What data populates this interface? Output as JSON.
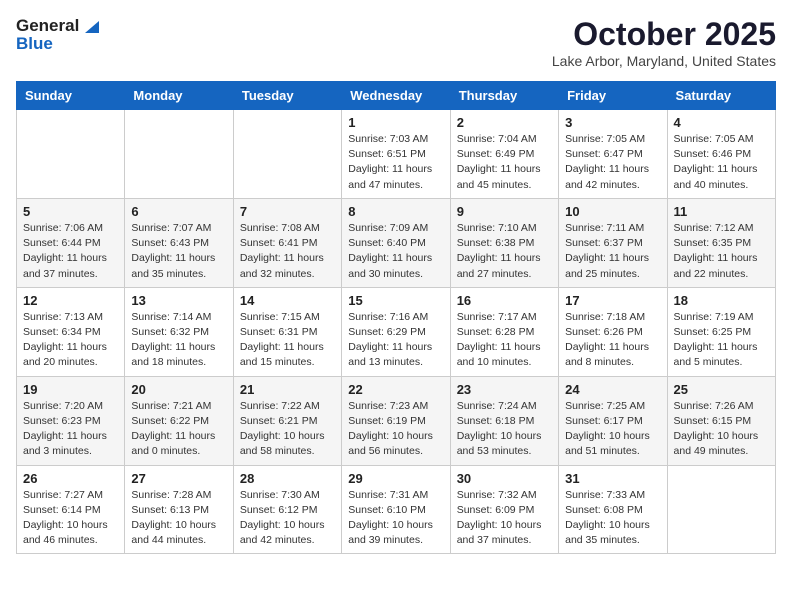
{
  "logo": {
    "line1": "General",
    "line2": "Blue"
  },
  "title": "October 2025",
  "location": "Lake Arbor, Maryland, United States",
  "headers": [
    "Sunday",
    "Monday",
    "Tuesday",
    "Wednesday",
    "Thursday",
    "Friday",
    "Saturday"
  ],
  "weeks": [
    [
      {
        "day": "",
        "info": ""
      },
      {
        "day": "",
        "info": ""
      },
      {
        "day": "",
        "info": ""
      },
      {
        "day": "1",
        "info": "Sunrise: 7:03 AM\nSunset: 6:51 PM\nDaylight: 11 hours\nand 47 minutes."
      },
      {
        "day": "2",
        "info": "Sunrise: 7:04 AM\nSunset: 6:49 PM\nDaylight: 11 hours\nand 45 minutes."
      },
      {
        "day": "3",
        "info": "Sunrise: 7:05 AM\nSunset: 6:47 PM\nDaylight: 11 hours\nand 42 minutes."
      },
      {
        "day": "4",
        "info": "Sunrise: 7:05 AM\nSunset: 6:46 PM\nDaylight: 11 hours\nand 40 minutes."
      }
    ],
    [
      {
        "day": "5",
        "info": "Sunrise: 7:06 AM\nSunset: 6:44 PM\nDaylight: 11 hours\nand 37 minutes."
      },
      {
        "day": "6",
        "info": "Sunrise: 7:07 AM\nSunset: 6:43 PM\nDaylight: 11 hours\nand 35 minutes."
      },
      {
        "day": "7",
        "info": "Sunrise: 7:08 AM\nSunset: 6:41 PM\nDaylight: 11 hours\nand 32 minutes."
      },
      {
        "day": "8",
        "info": "Sunrise: 7:09 AM\nSunset: 6:40 PM\nDaylight: 11 hours\nand 30 minutes."
      },
      {
        "day": "9",
        "info": "Sunrise: 7:10 AM\nSunset: 6:38 PM\nDaylight: 11 hours\nand 27 minutes."
      },
      {
        "day": "10",
        "info": "Sunrise: 7:11 AM\nSunset: 6:37 PM\nDaylight: 11 hours\nand 25 minutes."
      },
      {
        "day": "11",
        "info": "Sunrise: 7:12 AM\nSunset: 6:35 PM\nDaylight: 11 hours\nand 22 minutes."
      }
    ],
    [
      {
        "day": "12",
        "info": "Sunrise: 7:13 AM\nSunset: 6:34 PM\nDaylight: 11 hours\nand 20 minutes."
      },
      {
        "day": "13",
        "info": "Sunrise: 7:14 AM\nSunset: 6:32 PM\nDaylight: 11 hours\nand 18 minutes."
      },
      {
        "day": "14",
        "info": "Sunrise: 7:15 AM\nSunset: 6:31 PM\nDaylight: 11 hours\nand 15 minutes."
      },
      {
        "day": "15",
        "info": "Sunrise: 7:16 AM\nSunset: 6:29 PM\nDaylight: 11 hours\nand 13 minutes."
      },
      {
        "day": "16",
        "info": "Sunrise: 7:17 AM\nSunset: 6:28 PM\nDaylight: 11 hours\nand 10 minutes."
      },
      {
        "day": "17",
        "info": "Sunrise: 7:18 AM\nSunset: 6:26 PM\nDaylight: 11 hours\nand 8 minutes."
      },
      {
        "day": "18",
        "info": "Sunrise: 7:19 AM\nSunset: 6:25 PM\nDaylight: 11 hours\nand 5 minutes."
      }
    ],
    [
      {
        "day": "19",
        "info": "Sunrise: 7:20 AM\nSunset: 6:23 PM\nDaylight: 11 hours\nand 3 minutes."
      },
      {
        "day": "20",
        "info": "Sunrise: 7:21 AM\nSunset: 6:22 PM\nDaylight: 11 hours\nand 0 minutes."
      },
      {
        "day": "21",
        "info": "Sunrise: 7:22 AM\nSunset: 6:21 PM\nDaylight: 10 hours\nand 58 minutes."
      },
      {
        "day": "22",
        "info": "Sunrise: 7:23 AM\nSunset: 6:19 PM\nDaylight: 10 hours\nand 56 minutes."
      },
      {
        "day": "23",
        "info": "Sunrise: 7:24 AM\nSunset: 6:18 PM\nDaylight: 10 hours\nand 53 minutes."
      },
      {
        "day": "24",
        "info": "Sunrise: 7:25 AM\nSunset: 6:17 PM\nDaylight: 10 hours\nand 51 minutes."
      },
      {
        "day": "25",
        "info": "Sunrise: 7:26 AM\nSunset: 6:15 PM\nDaylight: 10 hours\nand 49 minutes."
      }
    ],
    [
      {
        "day": "26",
        "info": "Sunrise: 7:27 AM\nSunset: 6:14 PM\nDaylight: 10 hours\nand 46 minutes."
      },
      {
        "day": "27",
        "info": "Sunrise: 7:28 AM\nSunset: 6:13 PM\nDaylight: 10 hours\nand 44 minutes."
      },
      {
        "day": "28",
        "info": "Sunrise: 7:30 AM\nSunset: 6:12 PM\nDaylight: 10 hours\nand 42 minutes."
      },
      {
        "day": "29",
        "info": "Sunrise: 7:31 AM\nSunset: 6:10 PM\nDaylight: 10 hours\nand 39 minutes."
      },
      {
        "day": "30",
        "info": "Sunrise: 7:32 AM\nSunset: 6:09 PM\nDaylight: 10 hours\nand 37 minutes."
      },
      {
        "day": "31",
        "info": "Sunrise: 7:33 AM\nSunset: 6:08 PM\nDaylight: 10 hours\nand 35 minutes."
      },
      {
        "day": "",
        "info": ""
      }
    ]
  ]
}
